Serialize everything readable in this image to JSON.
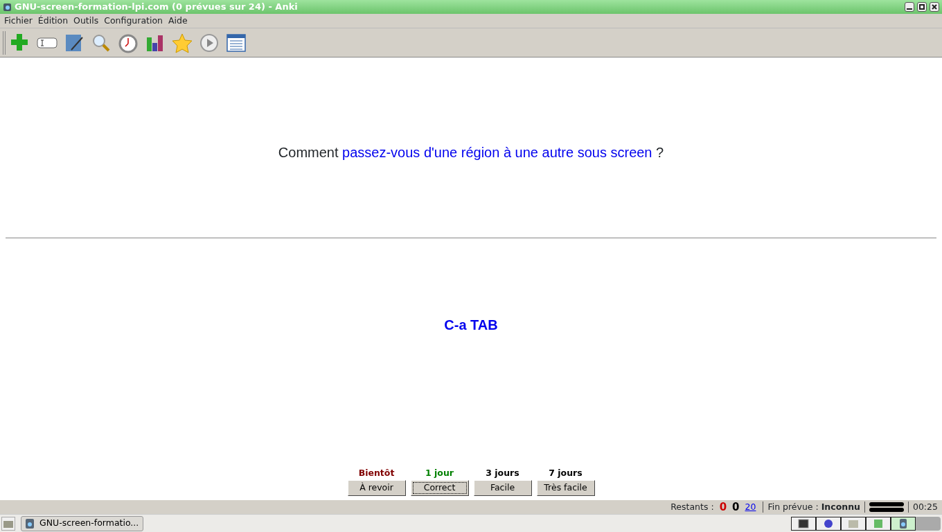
{
  "window": {
    "title": "GNU-screen-formation-lpi.com (0 prévues sur 24) - Anki"
  },
  "menu": [
    {
      "label": "Fichier"
    },
    {
      "label": "Édition"
    },
    {
      "label": "Outils"
    },
    {
      "label": "Configuration"
    },
    {
      "label": "Aide"
    }
  ],
  "toolbar": [
    {
      "kind": "add"
    },
    {
      "kind": "field"
    },
    {
      "kind": "edit"
    },
    {
      "kind": "search"
    },
    {
      "kind": "timer"
    },
    {
      "kind": "chart"
    },
    {
      "kind": "star"
    },
    {
      "kind": "play"
    },
    {
      "kind": "list"
    }
  ],
  "question": {
    "prefix": "Comment ",
    "highlight": "passez-vous d'une région à une autre sous screen",
    "suffix": " ?"
  },
  "answer": "C-a TAB",
  "answer_buttons": [
    {
      "interval": "Bientôt",
      "color": "#800000",
      "label": "À revoir",
      "focused": false
    },
    {
      "interval": "1 jour",
      "color": "#008000",
      "label": "Correct",
      "focused": true
    },
    {
      "interval": "3 jours",
      "color": "#000000",
      "label": "Facile",
      "focused": false
    },
    {
      "interval": "7 jours",
      "color": "#000000",
      "label": "Très facile",
      "focused": false
    }
  ],
  "status_bar": {
    "remaining_label": "Restants :",
    "counts": [
      {
        "value": "0",
        "color": "#cc0000"
      },
      {
        "value": "0",
        "color": "#000000"
      },
      {
        "value": "20",
        "color": "#0000ee"
      }
    ],
    "eta_label": "Fin prévue :",
    "eta": "Inconnu",
    "time": "00:25"
  },
  "taskbar": {
    "task": "GNU-screen-formatio...",
    "tray": [
      {
        "kind": "terminal",
        "selected": false
      },
      {
        "kind": "globe",
        "selected": false
      },
      {
        "kind": "folder",
        "selected": false
      },
      {
        "kind": "image",
        "selected": false
      },
      {
        "kind": "anki",
        "selected": true
      }
    ]
  }
}
